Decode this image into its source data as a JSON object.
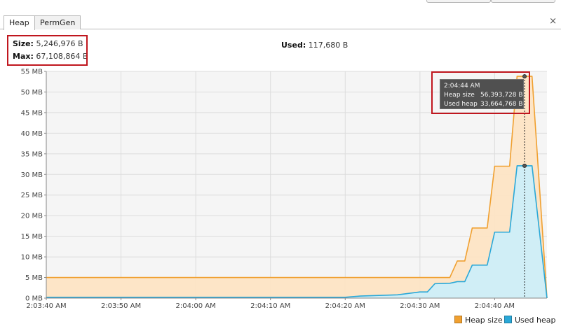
{
  "tabs": [
    {
      "label": "Heap",
      "active": true
    },
    {
      "label": "PermGen",
      "active": false
    }
  ],
  "tab_close_glyph": "×",
  "info": {
    "size_label": "Size:",
    "size_value": "5,246,976 B",
    "max_label": "Max:",
    "max_value": "67,108,864 B",
    "used_label": "Used:",
    "used_value": "117,680 B"
  },
  "tooltip": {
    "time": "2:04:44 AM",
    "heap_size_label": "Heap size",
    "heap_size_value": "56,393,728 B",
    "used_heap_label": "Used heap",
    "used_heap_value": "33,664,768 B"
  },
  "colors": {
    "heap_size": "#f0a030",
    "used_heap": "#2aa8d8",
    "highlight": "#c0161e"
  },
  "chart_data": {
    "type": "area",
    "ylim": [
      0,
      55
    ],
    "y_unit": "MB",
    "y_ticks": [
      "0 MB",
      "5 MB",
      "10 MB",
      "15 MB",
      "20 MB",
      "25 MB",
      "30 MB",
      "35 MB",
      "40 MB",
      "45 MB",
      "50 MB",
      "55 MB"
    ],
    "x_ticks": [
      "2:03:40 AM",
      "2:03:50 AM",
      "2:04:00 AM",
      "2:04:10 AM",
      "2:04:20 AM",
      "2:04:30 AM",
      "2:04:40 AM"
    ],
    "xlim": [
      "2:03:40 AM",
      "2:04:47 AM"
    ],
    "grid": true,
    "legend_position": "bottom-right",
    "series": [
      {
        "name": "Heap size",
        "points": [
          [
            "2:03:40 AM",
            5.0
          ],
          [
            "2:04:34 AM",
            5.0
          ],
          [
            "2:04:35 AM",
            9.0
          ],
          [
            "2:04:36 AM",
            9.0
          ],
          [
            "2:04:37 AM",
            17.0
          ],
          [
            "2:04:39 AM",
            17.0
          ],
          [
            "2:04:40 AM",
            32.0
          ],
          [
            "2:04:42 AM",
            32.0
          ],
          [
            "2:04:43 AM",
            53.8
          ],
          [
            "2:04:45 AM",
            53.8
          ],
          [
            "2:04:47 AM",
            0.0
          ]
        ]
      },
      {
        "name": "Used heap",
        "points": [
          [
            "2:03:40 AM",
            0.2
          ],
          [
            "2:04:20 AM",
            0.2
          ],
          [
            "2:04:22 AM",
            0.5
          ],
          [
            "2:04:27 AM",
            0.8
          ],
          [
            "2:04:30 AM",
            1.5
          ],
          [
            "2:04:31 AM",
            1.5
          ],
          [
            "2:04:32 AM",
            3.5
          ],
          [
            "2:04:34 AM",
            3.6
          ],
          [
            "2:04:35 AM",
            4.0
          ],
          [
            "2:04:36 AM",
            4.0
          ],
          [
            "2:04:37 AM",
            8.0
          ],
          [
            "2:04:39 AM",
            8.0
          ],
          [
            "2:04:40 AM",
            16.0
          ],
          [
            "2:04:42 AM",
            16.0
          ],
          [
            "2:04:43 AM",
            32.1
          ],
          [
            "2:04:45 AM",
            32.1
          ],
          [
            "2:04:47 AM",
            0.0
          ]
        ]
      }
    ],
    "marker_time": "2:04:44 AM"
  }
}
